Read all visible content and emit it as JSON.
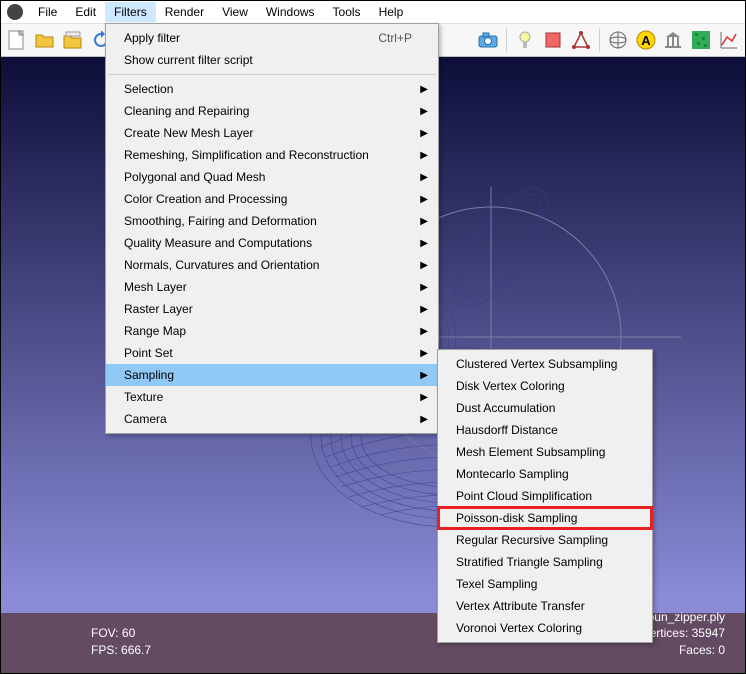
{
  "menu": {
    "items": [
      "File",
      "Edit",
      "Filters",
      "Render",
      "View",
      "Windows",
      "Tools",
      "Help"
    ],
    "activeIndex": 2
  },
  "dropdown": {
    "applyFilter": "Apply filter",
    "applyFilterShortcut": "Ctrl+P",
    "showScript": "Show current filter script",
    "categories": [
      "Selection",
      "Cleaning and Repairing",
      "Create New Mesh Layer",
      "Remeshing, Simplification and Reconstruction",
      "Polygonal and Quad Mesh",
      "Color Creation and Processing",
      "Smoothing, Fairing and Deformation",
      "Quality Measure and Computations",
      "Normals, Curvatures and Orientation",
      "Mesh Layer",
      "Raster Layer",
      "Range Map",
      "Point Set",
      "Sampling",
      "Texture",
      "Camera"
    ],
    "hoverIndex": 13
  },
  "submenu": {
    "items": [
      "Clustered Vertex Subsampling",
      "Disk Vertex Coloring",
      "Dust Accumulation",
      "Hausdorff Distance",
      "Mesh Element Subsampling",
      "Montecarlo Sampling",
      "Point Cloud Simplification",
      "Poisson-disk Sampling",
      "Regular Recursive Sampling",
      "Stratified Triangle Sampling",
      "Texel Sampling",
      "Vertex Attribute Transfer",
      "Voronoi Vertex Coloring"
    ],
    "highlightIndex": 7
  },
  "status": {
    "fovLabel": "FOV: ",
    "fov": "60",
    "fpsLabel": "FPS: ",
    "fps": "666.7",
    "meshLabel": "Mesh: bun_zipper.ply",
    "verticesLabel": "Vertices: ",
    "vertices": "35947",
    "facesLabel": "Faces: ",
    "faces": "0"
  },
  "icons": {
    "new": "new-doc-icon",
    "open": "open-folder-icon",
    "openStack": "open-project-icon",
    "reload": "reload-icon",
    "save": "save-icon",
    "snapshot": "snapshot-icon",
    "camera": "camera-icon",
    "photo": "photo-icon",
    "cube": "cube-icon",
    "light": "light-icon",
    "select-face": "select-face-icon",
    "select-vert": "select-vert-icon",
    "globe": "globe-icon",
    "measure": "measure-a-icon",
    "museum": "museum-icon",
    "noise": "noise-icon",
    "chart": "chart-icon"
  }
}
